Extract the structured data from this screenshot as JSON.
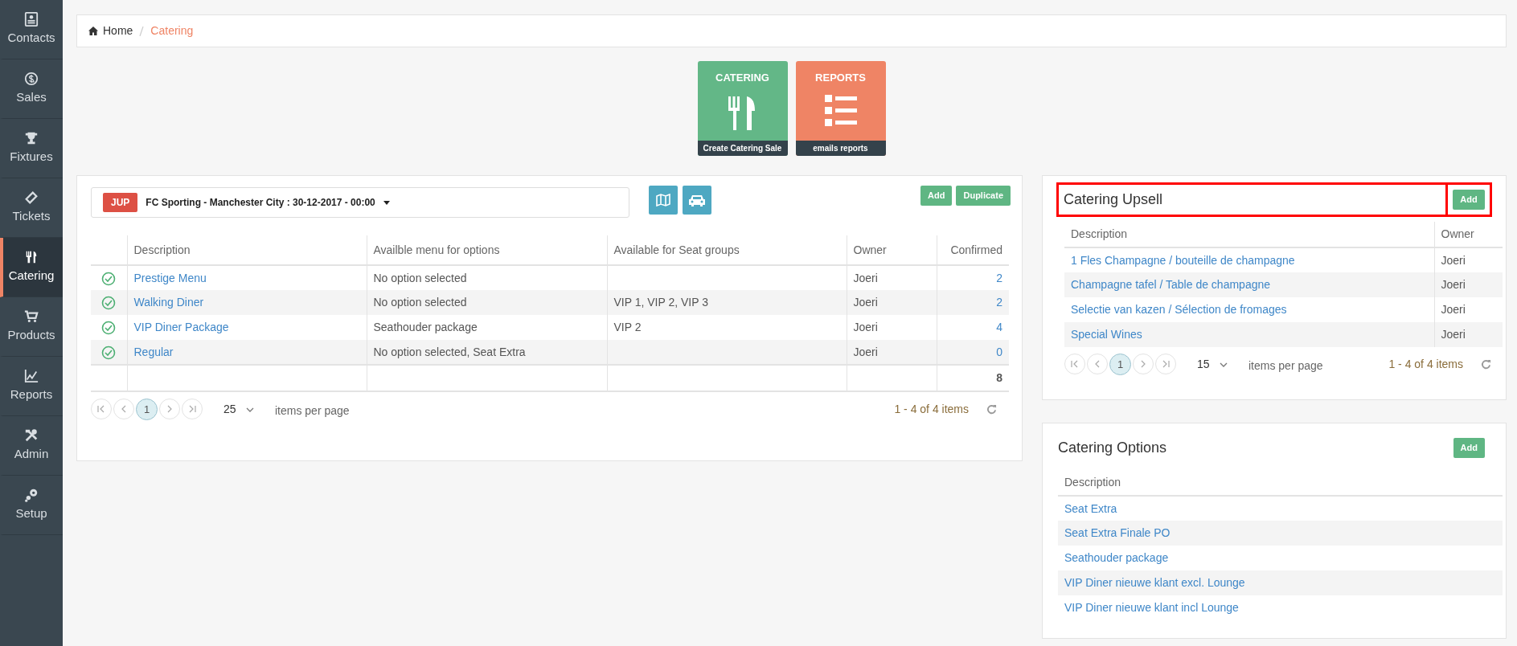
{
  "sidebar": {
    "items": [
      {
        "label": "Contacts",
        "kind": "contacts",
        "selected": false
      },
      {
        "label": "Sales",
        "kind": "sales",
        "selected": false
      },
      {
        "label": "Fixtures",
        "kind": "fixtures",
        "selected": false
      },
      {
        "label": "Tickets",
        "kind": "tickets",
        "selected": false
      },
      {
        "label": "Catering",
        "kind": "catering",
        "selected": true
      },
      {
        "label": "Products",
        "kind": "products",
        "selected": false
      },
      {
        "label": "Reports",
        "kind": "reports",
        "selected": false
      },
      {
        "label": "Admin",
        "kind": "admin",
        "selected": false
      },
      {
        "label": "Setup",
        "kind": "setup",
        "selected": false
      }
    ]
  },
  "breadcrumb": [
    {
      "label": "Home",
      "kind": "home"
    },
    {
      "label": "Catering",
      "kind": "current"
    }
  ],
  "tiles": [
    {
      "title": "CATERING",
      "caption": "Create Catering Sale",
      "kind": "catering",
      "color": "#63b787"
    },
    {
      "title": "REPORTS",
      "caption": "emails reports",
      "kind": "reports",
      "color": "#ef8465"
    }
  ],
  "event_panel": {
    "event_selector": {
      "badge": "JUP",
      "label": "FC Sporting - Manchester City : 30-12-2017 - 00:00"
    },
    "buttons": [
      "Add",
      "Duplicate"
    ],
    "table": {
      "columns": [
        "Description",
        "Availble menu for options",
        "Available for Seat groups",
        "Owner",
        "Confirmed"
      ],
      "rows": [
        {
          "description": "Prestige Menu",
          "menu_options": "No option selected",
          "seat_groups": "",
          "owner": "Joeri",
          "confirmed": "2"
        },
        {
          "description": "Walking Diner",
          "menu_options": "No option selected",
          "seat_groups": "VIP 1, VIP 2, VIP 3",
          "owner": "Joeri",
          "confirmed": "2"
        },
        {
          "description": "VIP Diner Package",
          "menu_options": "Seathouder package",
          "seat_groups": "VIP 2",
          "owner": "Joeri",
          "confirmed": "4"
        },
        {
          "description": "Regular",
          "menu_options": "No option selected, Seat Extra",
          "seat_groups": "",
          "owner": "Joeri",
          "confirmed": "0"
        }
      ],
      "total": "8"
    },
    "pager": {
      "page": "1",
      "page_size": "25",
      "per_page_label": "items per page",
      "summary": "1 - 4 of 4 items"
    }
  },
  "upsell_panel": {
    "title": "Catering Upsell",
    "add_button": "Add",
    "highlighted": true,
    "table": {
      "columns": [
        "Description",
        "Owner"
      ],
      "rows": [
        {
          "description": "1 Fles Champagne / bouteille de champagne",
          "owner": "Joeri"
        },
        {
          "description": "Champagne tafel / Table de champagne",
          "owner": "Joeri"
        },
        {
          "description": "Selectie van kazen / Sélection de fromages",
          "owner": "Joeri"
        },
        {
          "description": "Special Wines",
          "owner": "Joeri"
        }
      ]
    },
    "pager": {
      "page": "1",
      "page_size": "15",
      "per_page_label": "items per page",
      "summary": "1 - 4 of 4 items"
    }
  },
  "options_panel": {
    "title": "Catering Options",
    "add_button": "Add",
    "table": {
      "columns": [
        "Description"
      ],
      "rows": [
        "Seat Extra",
        "Seat Extra Finale PO",
        "Seathouder package",
        "VIP Diner nieuwe klant excl. Lounge",
        "VIP Diner nieuwe klant incl Lounge"
      ]
    }
  }
}
